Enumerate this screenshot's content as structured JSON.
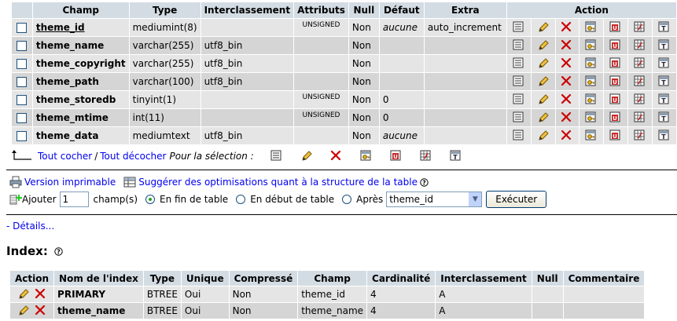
{
  "structure": {
    "headers": [
      "Champ",
      "Type",
      "Interclassement",
      "Attributs",
      "Null",
      "Défaut",
      "Extra",
      "Action"
    ],
    "rows": [
      {
        "field": "theme_id",
        "type": "mediumint(8)",
        "collation": "",
        "attributes": "UNSIGNED",
        "null": "Non",
        "default": "aucune",
        "extra": "auto_increment"
      },
      {
        "field": "theme_name",
        "type": "varchar(255)",
        "collation": "utf8_bin",
        "attributes": "",
        "null": "Non",
        "default": "",
        "extra": ""
      },
      {
        "field": "theme_copyright",
        "type": "varchar(255)",
        "collation": "utf8_bin",
        "attributes": "",
        "null": "Non",
        "default": "",
        "extra": ""
      },
      {
        "field": "theme_path",
        "type": "varchar(100)",
        "collation": "utf8_bin",
        "attributes": "",
        "null": "Non",
        "default": "",
        "extra": ""
      },
      {
        "field": "theme_storedb",
        "type": "tinyint(1)",
        "collation": "",
        "attributes": "UNSIGNED",
        "null": "Non",
        "default": "0",
        "extra": ""
      },
      {
        "field": "theme_mtime",
        "type": "int(11)",
        "collation": "",
        "attributes": "UNSIGNED",
        "null": "Non",
        "default": "0",
        "extra": ""
      },
      {
        "field": "theme_data",
        "type": "mediumtext",
        "collation": "utf8_bin",
        "attributes": "",
        "null": "Non",
        "default": "aucune",
        "extra": ""
      }
    ],
    "action_icons": [
      "browse-icon",
      "edit-pencil-icon",
      "drop-x-icon",
      "primary-key-icon",
      "unique-icon",
      "index-icon",
      "fulltext-icon"
    ]
  },
  "selection": {
    "check_all": "Tout cocher",
    "separator": "/",
    "uncheck_all": "Tout décocher",
    "for_selection": "Pour la sélection :"
  },
  "tools": {
    "print_view": "Version imprimable",
    "propose_structure": "Suggérer des optimisations quant à la structure de la table"
  },
  "add_fields": {
    "add_label": "Ajouter",
    "count_value": "1",
    "fields_label": "champ(s)",
    "at_end": "En fin de table",
    "at_begin": "En début de table",
    "after": "Après",
    "after_field": "theme_id",
    "go_button": "Exécuter",
    "selected_option": "at_end"
  },
  "details_link": "- Détails...",
  "index": {
    "title": "Index:",
    "headers": [
      "Action",
      "Nom de l'index",
      "Type",
      "Unique",
      "Compressé",
      "Champ",
      "Cardinalité",
      "Interclassement",
      "Null",
      "Commentaire"
    ],
    "rows": [
      {
        "name": "PRIMARY",
        "type": "BTREE",
        "unique": "Oui",
        "packed": "Non",
        "field": "theme_id",
        "cardinality": "4",
        "collation": "A",
        "null": "",
        "comment": ""
      },
      {
        "name": "theme_name",
        "type": "BTREE",
        "unique": "Oui",
        "packed": "Non",
        "field": "theme_name",
        "cardinality": "4",
        "collation": "A",
        "null": "",
        "comment": ""
      }
    ]
  },
  "colors": {
    "header_bg": "#d3dce3",
    "row_odd": "#e5e5e5",
    "row_even": "#d5d5d5",
    "link": "#0000ee",
    "drop_red": "#cc0000"
  }
}
